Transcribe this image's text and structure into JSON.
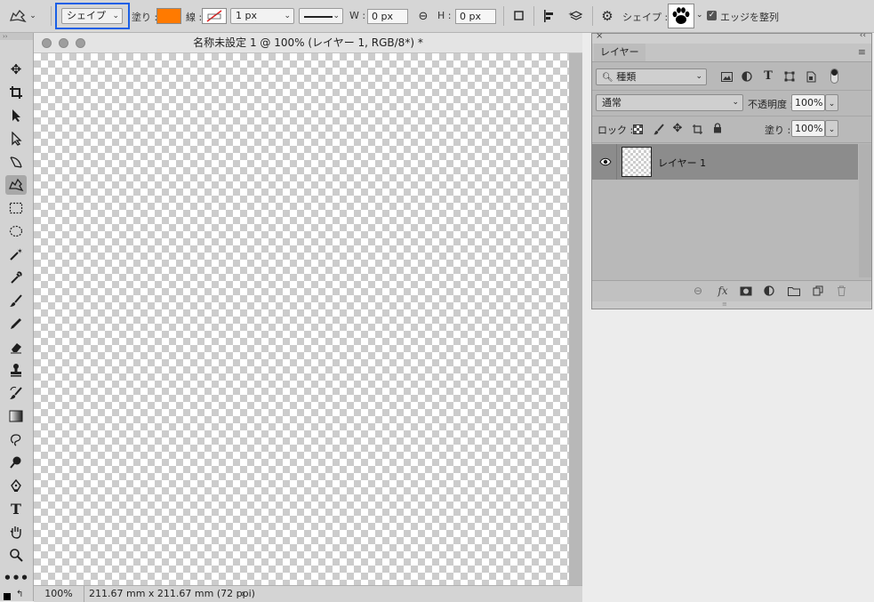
{
  "options_bar": {
    "tool_icon": "custom-shape-tool-icon",
    "mode_select": "シェイプ",
    "fill_label": "塗り :",
    "fill_color": "#ff7a00",
    "stroke_label": "線 :",
    "stroke_width": "1 px",
    "w_label": "W :",
    "w_value": "0 px",
    "h_label": "H :",
    "h_value": "0 px",
    "shape_label": "シェイプ :",
    "shape_preview": "paw-print",
    "align_edges_label": "エッジを整列",
    "align_edges_checked": true,
    "highlight_color": "#1a5fe6"
  },
  "document": {
    "title": "名称未設定 1 @ 100% (レイヤー 1, RGB/8*) *",
    "zoom": "100%",
    "info": "211.67 mm x 211.67 mm (72 ppi)",
    "info_arrow": "›"
  },
  "layers_panel": {
    "tab": "レイヤー",
    "filter_select": "種類",
    "blend_mode": "通常",
    "opacity_label": "不透明度 :",
    "opacity_value": "100%",
    "lock_label": "ロック :",
    "fill_label": "塗り :",
    "fill_value": "100%",
    "layers": [
      {
        "name": "レイヤー 1",
        "visible": true,
        "selected": true
      }
    ]
  },
  "toolbar": {
    "tools": [
      "move-tool",
      "crop-tool",
      "path-selection-tool",
      "direct-selection-tool",
      "freeform-pen-tool",
      "custom-shape-tool",
      "rectangular-marquee-tool",
      "elliptical-marquee-tool",
      "magic-wand-tool",
      "eyedropper-tool",
      "brush-tool",
      "pencil-tool",
      "eraser-tool",
      "clone-stamp-tool",
      "history-brush-tool",
      "gradient-tool",
      "lasso-tool",
      "dodge-tool",
      "pen-tool",
      "type-tool",
      "hand-tool",
      "zoom-tool",
      "more-tools"
    ]
  }
}
